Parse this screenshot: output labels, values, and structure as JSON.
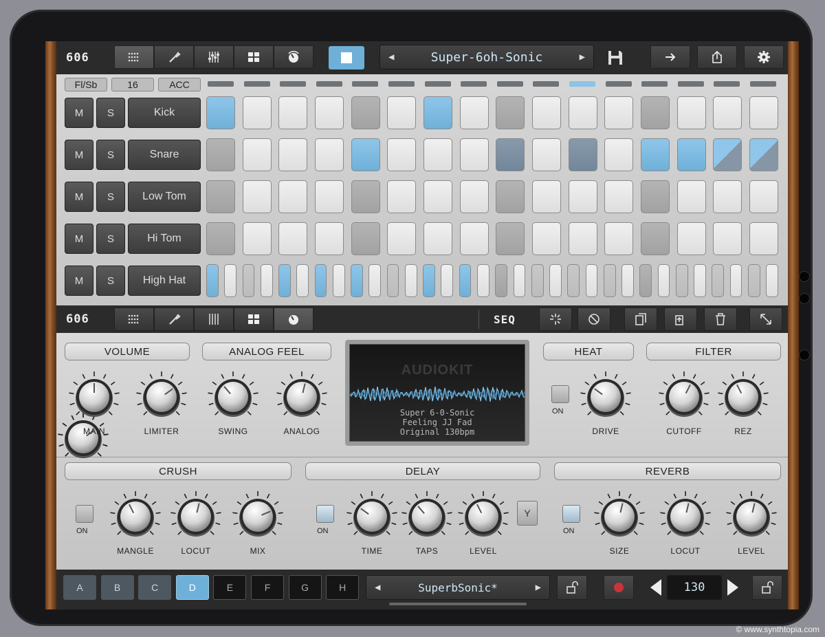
{
  "top_bar": {
    "logo": "606",
    "preset_name": "Super-6oh-Sonic"
  },
  "seq_header": {
    "flam_btn": "Fl/Sb",
    "steps_btn": "16",
    "accent_btn": "ACC",
    "active_led": 10
  },
  "tracks": [
    {
      "name": "Kick",
      "mute": "M",
      "solo": "S",
      "steps": [
        "blue",
        "light",
        "light",
        "light",
        "mid",
        "light",
        "blue",
        "light",
        "mid",
        "light",
        "light",
        "light",
        "mid",
        "light",
        "light",
        "light"
      ]
    },
    {
      "name": "Snare",
      "mute": "M",
      "solo": "S",
      "steps": [
        "mid",
        "light",
        "light",
        "light",
        "blue",
        "light",
        "light",
        "light",
        "steel",
        "light",
        "steel",
        "light",
        "blue",
        "blue",
        "half",
        "half"
      ]
    },
    {
      "name": "Low Tom",
      "mute": "M",
      "solo": "S",
      "steps": [
        "mid",
        "light",
        "light",
        "light",
        "mid",
        "light",
        "light",
        "light",
        "mid",
        "light",
        "light",
        "light",
        "mid",
        "light",
        "light",
        "light"
      ]
    },
    {
      "name": "Hi Tom",
      "mute": "M",
      "solo": "S",
      "steps": [
        "mid",
        "light",
        "light",
        "light",
        "mid",
        "light",
        "light",
        "light",
        "mid",
        "light",
        "light",
        "light",
        "mid",
        "light",
        "light",
        "light"
      ]
    },
    {
      "name": "High Hat",
      "mute": "M",
      "solo": "S",
      "steps": [
        "blue",
        "light",
        "dim",
        "light",
        "blue",
        "light",
        "blue",
        "light",
        "blue",
        "light",
        "dim",
        "light",
        "blue",
        "light",
        "blue",
        "light",
        "mid",
        "light",
        "dim",
        "light",
        "dim",
        "light",
        "dim",
        "light",
        "mid",
        "light",
        "dim",
        "light",
        "dim",
        "light",
        "dim",
        "light"
      ]
    }
  ],
  "mid_bar": {
    "logo": "606",
    "seq_label": "SEQ"
  },
  "fx": {
    "volume": {
      "title": "VOLUME",
      "knobs": [
        {
          "label": "MAIN",
          "value": 0.5
        },
        {
          "label": "LIMITER",
          "value": 0.7
        }
      ]
    },
    "analog_feel": {
      "title": "ANALOG FEEL",
      "knobs": [
        {
          "label": "SWING",
          "value": 0.35
        },
        {
          "label": "ANALOG",
          "value": 0.55
        }
      ]
    },
    "heat": {
      "title": "HEAT",
      "switch_label": "ON",
      "knobs": [
        {
          "label": "DRIVE",
          "value": 0.3
        }
      ]
    },
    "filter": {
      "title": "FILTER",
      "knobs": [
        {
          "label": "CUTOFF",
          "value": 0.6
        },
        {
          "label": "REZ",
          "value": 0.4
        }
      ]
    },
    "crush": {
      "title": "CRUSH",
      "switch_label": "ON",
      "knobs": [
        {
          "label": "MANGLE",
          "value": 0.4
        },
        {
          "label": "LOCUT",
          "value": 0.55
        },
        {
          "label": "MIX",
          "value": 0.75
        }
      ]
    },
    "delay": {
      "title": "DELAY",
      "switch_label": "ON",
      "knobs": [
        {
          "label": "TIME",
          "value": 0.3
        },
        {
          "label": "TAPS",
          "value": 0.35
        },
        {
          "label": "LEVEL",
          "value": 0.4
        }
      ]
    },
    "reverb": {
      "title": "REVERB",
      "switch_label": "ON",
      "knobs": [
        {
          "label": "SIZE",
          "value": 0.55
        },
        {
          "label": "LOCUT",
          "value": 0.55
        },
        {
          "label": "LEVEL",
          "value": 0.55
        }
      ]
    }
  },
  "display": {
    "brand": "AUDIOKIT",
    "line1": "Super 6-0-Sonic",
    "line2": "Feeling JJ Fad",
    "line3": "Original 130bpm"
  },
  "bottom": {
    "patterns": [
      "A",
      "B",
      "C",
      "D",
      "E",
      "F",
      "G",
      "H"
    ],
    "current_pattern": 3,
    "kit_name": "SuperbSonic*",
    "tempo": "130"
  },
  "colors": {
    "accent": "#6fb0d8",
    "step_light": "#e6e6e6",
    "step_mid": "#a8a8a8"
  },
  "watermark": "© www.synthtopia.com"
}
